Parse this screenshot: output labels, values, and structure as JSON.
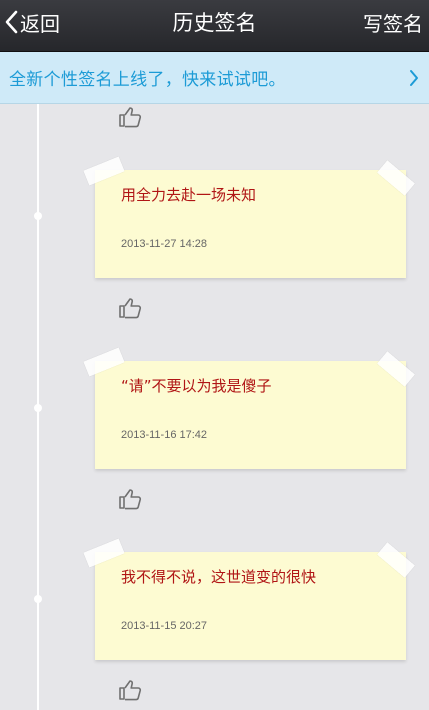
{
  "header": {
    "back_label": "返回",
    "title": "历史签名",
    "write_label": "写签名"
  },
  "banner": {
    "text": "全新个性签名上线了，快来试试吧。"
  },
  "signatures": [
    {
      "text": "用全力去赴一场未知",
      "date": "2013-11-27 14:28"
    },
    {
      "text": "“请”不要以为我是傻子",
      "date": "2013-11-16 17:42"
    },
    {
      "text": "我不得不说，这世道变的很快",
      "date": "2013-11-15 20:27"
    }
  ],
  "icons": {
    "back": "chevron-left-icon",
    "banner_arrow": "chevron-right-icon",
    "like": "thumbs-up-icon"
  },
  "colors": {
    "topbar": "#2e2f33",
    "banner_bg": "#cfeaf8",
    "banner_text": "#1c9bd6",
    "note_bg": "#fdfbd2",
    "note_text": "#b01515",
    "date_text": "#666666",
    "page_bg": "#e6e6e9"
  }
}
